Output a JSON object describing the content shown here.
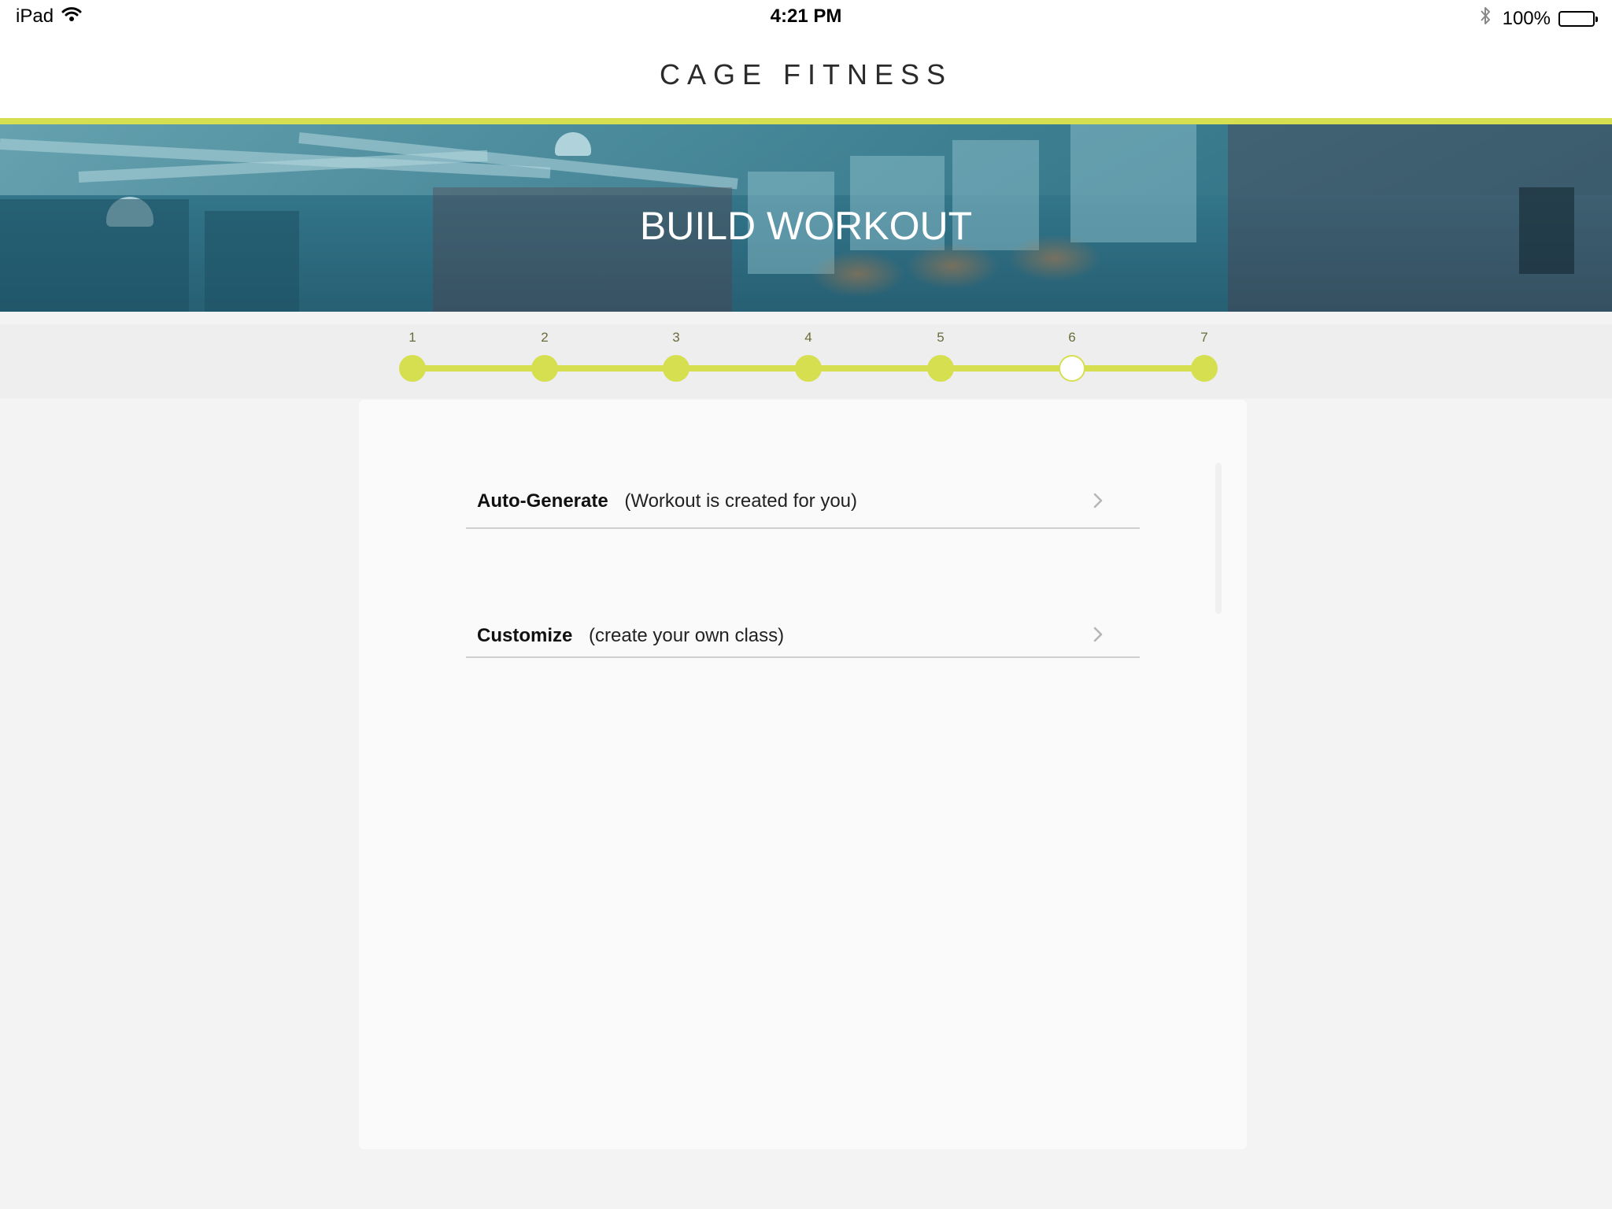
{
  "status_bar": {
    "device": "iPad",
    "time": "4:21 PM",
    "battery_percent": "100%",
    "battery_level": 1.0
  },
  "header": {
    "app_title": "CAGE FITNESS"
  },
  "hero": {
    "title": "BUILD WORKOUT"
  },
  "steps": {
    "labels": [
      "1",
      "2",
      "3",
      "4",
      "5",
      "6",
      "7"
    ],
    "current": 6
  },
  "options": [
    {
      "title": "Auto-Generate",
      "description": "(Workout is created for you)"
    },
    {
      "title": "Customize",
      "description": "(create your own class)"
    }
  ],
  "colors": {
    "accent": "#d6df4f",
    "hero": "#2f6f84",
    "background": "#f3f3f3",
    "card": "#fafafa"
  },
  "icons": [
    "wifi-icon",
    "bluetooth-icon",
    "battery-icon",
    "chevron-right-icon"
  ]
}
